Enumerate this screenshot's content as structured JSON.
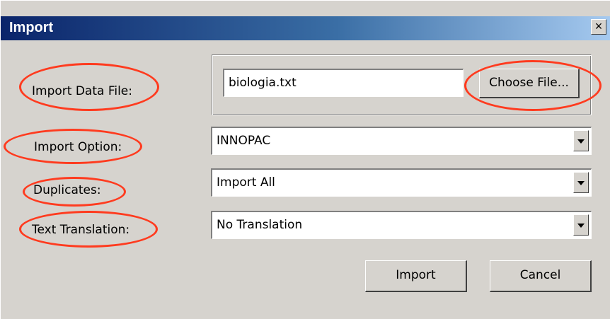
{
  "window": {
    "title": "Import",
    "close_label": "×"
  },
  "form": {
    "import_data_file": {
      "label": "Import Data File:",
      "value": "biologia.txt",
      "choose_label": "Choose File..."
    },
    "import_option": {
      "label": "Import Option:",
      "selected": "INNOPAC"
    },
    "duplicates": {
      "label": "Duplicates:",
      "selected": "Import All"
    },
    "text_translation": {
      "label": "Text Translation:",
      "selected": "No Translation"
    }
  },
  "buttons": {
    "import_label": "Import",
    "cancel_label": "Cancel"
  },
  "colors": {
    "annotation": "#ff3b1f",
    "dialog_bg": "#d6d3ce",
    "titlebar_start": "#0a246a",
    "titlebar_end": "#a6caf0"
  }
}
